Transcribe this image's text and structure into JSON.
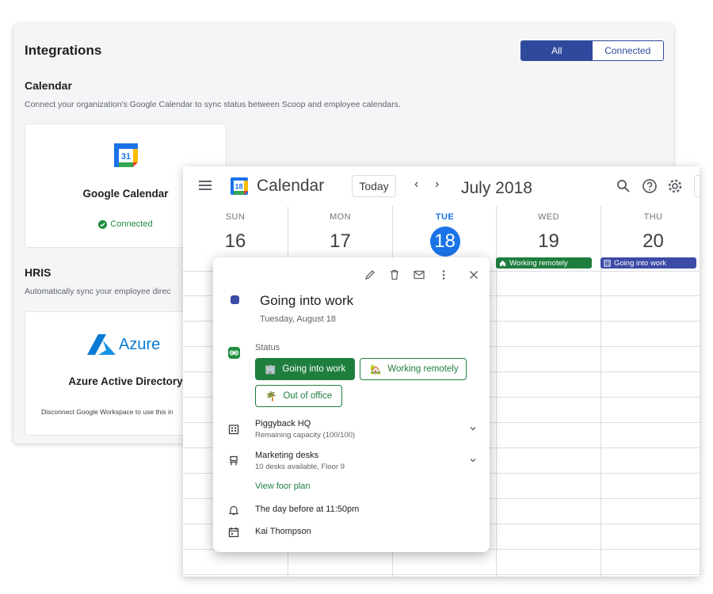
{
  "integrations": {
    "title": "Integrations",
    "filters": {
      "all": "All",
      "connected": "Connected",
      "active": "all"
    },
    "calendar_section": {
      "title": "Calendar",
      "description": "Connect your organization's Google Calendar to sync status between Scoop and employee calendars.",
      "card": {
        "name": "Google Calendar",
        "logo_day": "31",
        "status": "Connected"
      }
    },
    "hris_section": {
      "title": "HRIS",
      "description": "Automatically sync your employee direc",
      "card": {
        "logo_text": "Azure",
        "name": "Azure Active Directory",
        "note": "Disconnect Google Workspace to use this in"
      }
    }
  },
  "calendar": {
    "app_name": "Calendar",
    "logo_day": "18",
    "today_label": "Today",
    "month_label": "July 2018",
    "days": [
      {
        "abbr": "SUN",
        "num": "16"
      },
      {
        "abbr": "MON",
        "num": "17"
      },
      {
        "abbr": "TUE",
        "num": "18",
        "today": true
      },
      {
        "abbr": "WED",
        "num": "19"
      },
      {
        "abbr": "THU",
        "num": "20"
      }
    ],
    "chips": {
      "wed": "Working remotely",
      "thu": "Going into work"
    }
  },
  "event": {
    "title": "Going into work",
    "date": "Tuesday, August 18",
    "status_label": "Status",
    "options": {
      "going": "Going into work",
      "remote": "Working remotely",
      "ooo": "Out of office",
      "selected": "going"
    },
    "office": {
      "name": "Piggyback HQ",
      "sub": "Remaining capacity (100/100)"
    },
    "desks": {
      "name": "Marketing desks",
      "sub": "10 desks available, Floor 9"
    },
    "link": "View foor plan",
    "reminder": "The day before at 11:50pm",
    "owner": "Kai Thompson"
  },
  "colors": {
    "primary_blue": "#2f4a9c",
    "google_blue": "#1a73e8",
    "status_green": "#1e7e3e",
    "event_indigo": "#3c4ba6"
  }
}
